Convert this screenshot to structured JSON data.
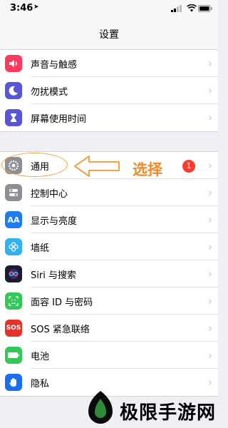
{
  "status_bar": {
    "time": "3:46",
    "location_arrow": "location-arrow-icon"
  },
  "nav": {
    "title": "设置"
  },
  "groups": [
    {
      "rows": [
        {
          "label": "声音与触感",
          "icon": "speaker-icon",
          "color": "#fe3b5e"
        },
        {
          "label": "勿扰模式",
          "icon": "moon-icon",
          "color": "#5856d6"
        },
        {
          "label": "屏幕使用时间",
          "icon": "hourglass-icon",
          "color": "#5856d6"
        }
      ]
    },
    {
      "rows": [
        {
          "label": "通用",
          "icon": "gear-icon",
          "color": "#8e8e93"
        },
        {
          "label": "控制中心",
          "icon": "toggles-icon",
          "color": "#8e8e93"
        },
        {
          "label": "显示与亮度",
          "icon": "text-size-icon",
          "icon_text": "AA",
          "color": "#1c7cf2"
        },
        {
          "label": "墙纸",
          "icon": "flower-icon",
          "color": "#2fb1f2"
        },
        {
          "label": "Siri 与搜索",
          "icon": "siri-icon",
          "color": "#1c1c2e"
        },
        {
          "label": "面容 ID 与密码",
          "icon": "face-id-icon",
          "color": "#34c759"
        },
        {
          "label": "SOS 紧急联络",
          "icon": "sos-icon",
          "icon_text": "SOS",
          "color": "#e5332a"
        },
        {
          "label": "电池",
          "icon": "battery-icon",
          "color": "#34c759"
        },
        {
          "label": "隐私",
          "icon": "hand-icon",
          "color": "#1a6ff0"
        }
      ]
    }
  ],
  "annotation": {
    "text": "选择",
    "badge": "1",
    "accent": "#ef8a2a"
  },
  "watermark": {
    "text": "极限手游网"
  }
}
